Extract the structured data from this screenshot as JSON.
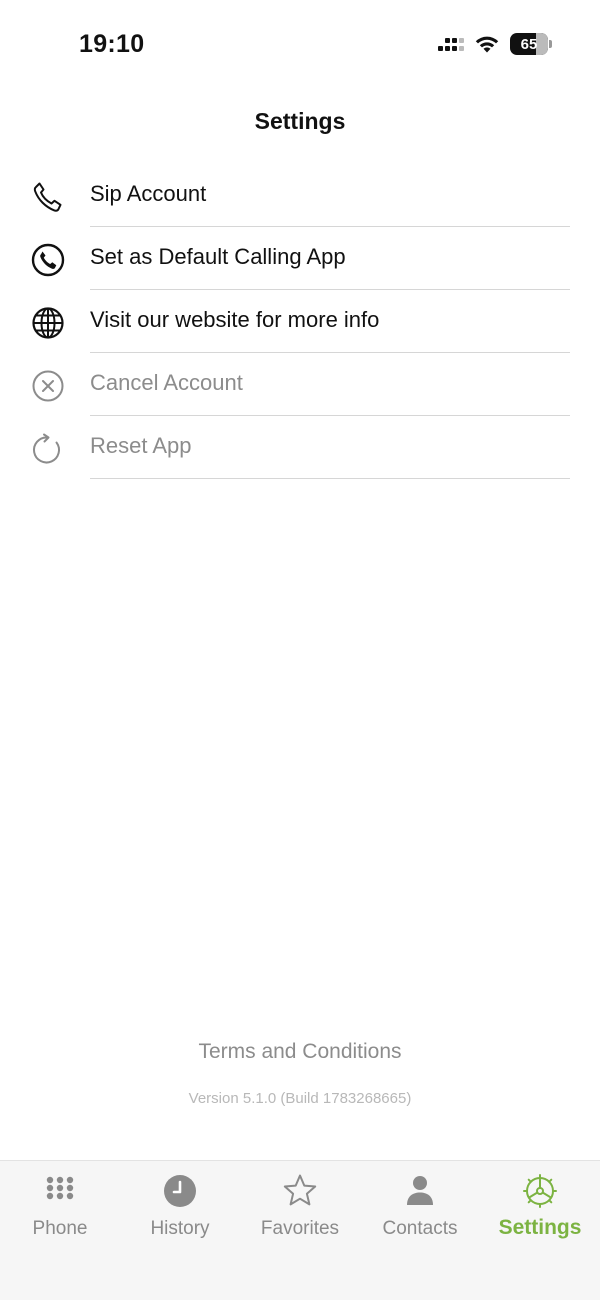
{
  "status_bar": {
    "time": "19:10",
    "battery": "65"
  },
  "header": {
    "title": "Settings"
  },
  "settings_items": [
    {
      "label": "Sip Account",
      "icon": "phone-icon",
      "muted": false
    },
    {
      "label": "Set as Default Calling App",
      "icon": "phone-circle-icon",
      "muted": false
    },
    {
      "label": "Visit our website for more info",
      "icon": "globe-icon",
      "muted": false
    },
    {
      "label": "Cancel Account",
      "icon": "cancel-circle-icon",
      "muted": true
    },
    {
      "label": "Reset App",
      "icon": "reset-icon",
      "muted": true
    }
  ],
  "footer": {
    "terms": "Terms and Conditions",
    "version": "Version 5.1.0 (Build 1783268665)"
  },
  "tab_bar": {
    "tabs": [
      {
        "label": "Phone",
        "icon": "keypad-icon"
      },
      {
        "label": "History",
        "icon": "clock-icon"
      },
      {
        "label": "Favorites",
        "icon": "star-icon"
      },
      {
        "label": "Contacts",
        "icon": "person-icon"
      },
      {
        "label": "Settings",
        "icon": "gear-icon"
      }
    ],
    "active_tab": "Settings"
  },
  "colors": {
    "accent": "#7cb342",
    "text": "#111111",
    "muted_text": "#8c8c8c",
    "divider": "#d6d6d6",
    "tab_inactive": "#8a8a8a",
    "tab_background": "#f6f6f6"
  }
}
